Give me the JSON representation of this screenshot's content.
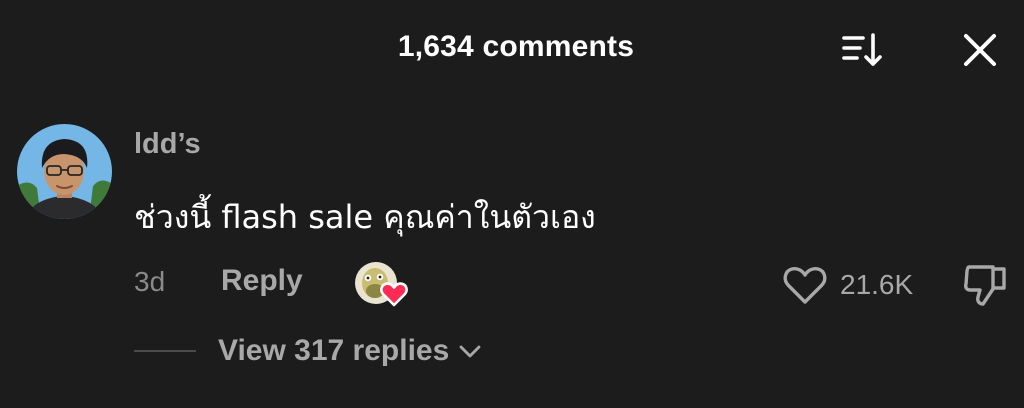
{
  "header": {
    "title": "1,634 comments",
    "sort_icon": "sort-descending-icon",
    "close_icon": "close-icon"
  },
  "comment": {
    "username": "ldd’s",
    "text": "ช่วงนี้ flash sale คุณค่าในตัวเอง",
    "timestamp": "3d",
    "reply_label": "Reply",
    "creator_liked_icon": "creator-liked-heart-icon",
    "like_count": "21.6K",
    "like_icon": "heart-outline-icon",
    "dislike_icon": "thumbs-down-icon",
    "view_replies_label": "View 317 replies",
    "view_replies_icon": "chevron-down-icon"
  },
  "colors": {
    "background": "#1c1c1c",
    "primary_text": "#ffffff",
    "secondary_text": "#a8a8a8",
    "heart_badge": "#fe2c55"
  }
}
